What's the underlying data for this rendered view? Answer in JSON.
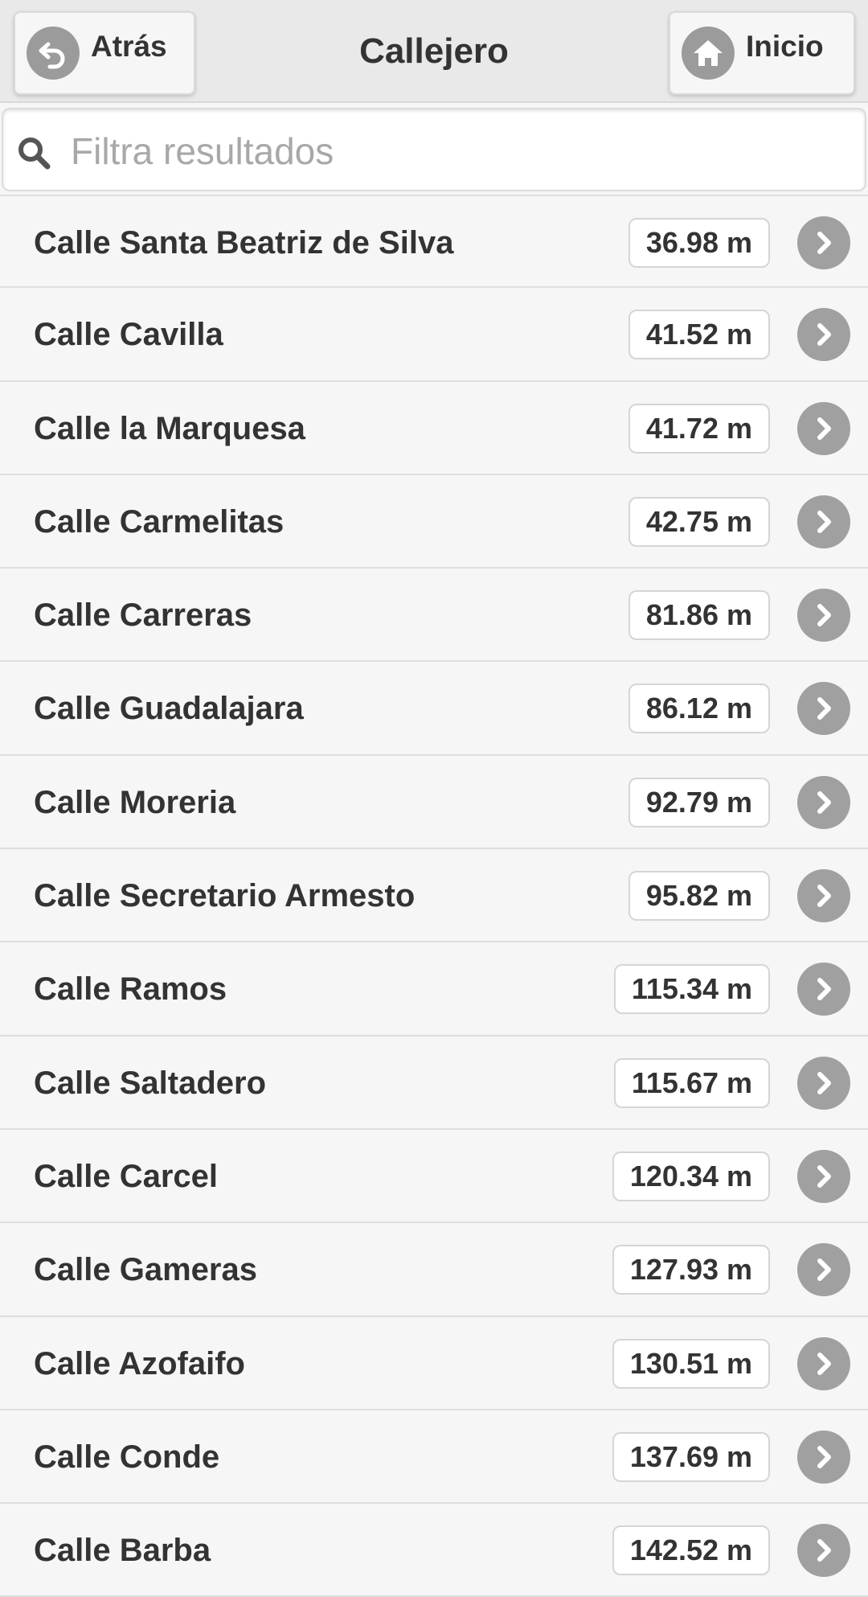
{
  "header": {
    "title": "Callejero",
    "back_label": "Atrás",
    "home_label": "Inicio"
  },
  "search": {
    "placeholder": "Filtra resultados",
    "value": ""
  },
  "streets": [
    {
      "name": "Calle Santa Beatriz de Silva",
      "distance": "36.98 m"
    },
    {
      "name": "Calle Cavilla",
      "distance": "41.52 m"
    },
    {
      "name": "Calle la Marquesa",
      "distance": "41.72 m"
    },
    {
      "name": "Calle Carmelitas",
      "distance": "42.75 m"
    },
    {
      "name": "Calle Carreras",
      "distance": "81.86 m"
    },
    {
      "name": "Calle Guadalajara",
      "distance": "86.12 m"
    },
    {
      "name": "Calle Moreria",
      "distance": "92.79 m"
    },
    {
      "name": "Calle Secretario Armesto",
      "distance": "95.82 m"
    },
    {
      "name": "Calle Ramos",
      "distance": "115.34 m"
    },
    {
      "name": "Calle Saltadero",
      "distance": "115.67 m"
    },
    {
      "name": "Calle Carcel",
      "distance": "120.34 m"
    },
    {
      "name": "Calle Gameras",
      "distance": "127.93 m"
    },
    {
      "name": "Calle Azofaifo",
      "distance": "130.51 m"
    },
    {
      "name": "Calle Conde",
      "distance": "137.69 m"
    },
    {
      "name": "Calle Barba",
      "distance": "142.52 m"
    }
  ],
  "icons": {
    "back": "back-arrow-icon",
    "home": "home-icon",
    "search": "search-icon",
    "row": "chevron-right-icon"
  },
  "colors": {
    "header_bg": "#e9e9e9",
    "list_bg": "#f6f6f6",
    "icon_gray": "#a0a0a0",
    "text": "#333333"
  }
}
